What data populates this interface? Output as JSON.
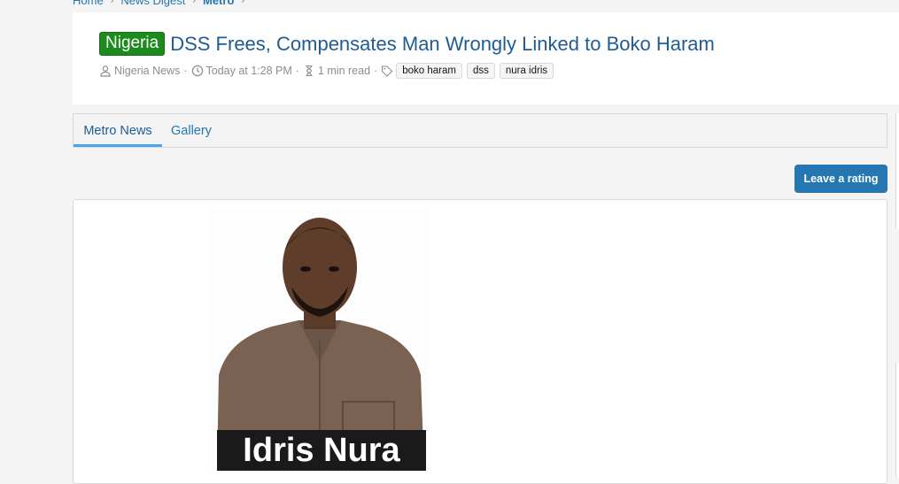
{
  "breadcrumb": {
    "items": [
      "Home",
      "News Digest",
      "Metro"
    ]
  },
  "thread": {
    "prefix": "Nigeria",
    "title": "DSS Frees, Compensates Man Wrongly Linked to Boko Haram",
    "author": "Nigeria News",
    "date": "Today at 1:28 PM",
    "read_time": "1 min read",
    "tags": [
      "boko haram",
      "dss",
      "nura idris"
    ]
  },
  "tabs": [
    {
      "label": "Metro News",
      "active": true
    },
    {
      "label": "Gallery",
      "active": false
    }
  ],
  "actions": {
    "rate_label": "Leave a rating"
  },
  "article": {
    "image_caption": "Idris Nura"
  },
  "colors": {
    "accent": "#2577b1",
    "prefix_green": "#1c8a1c",
    "title": "#1d5d94"
  }
}
